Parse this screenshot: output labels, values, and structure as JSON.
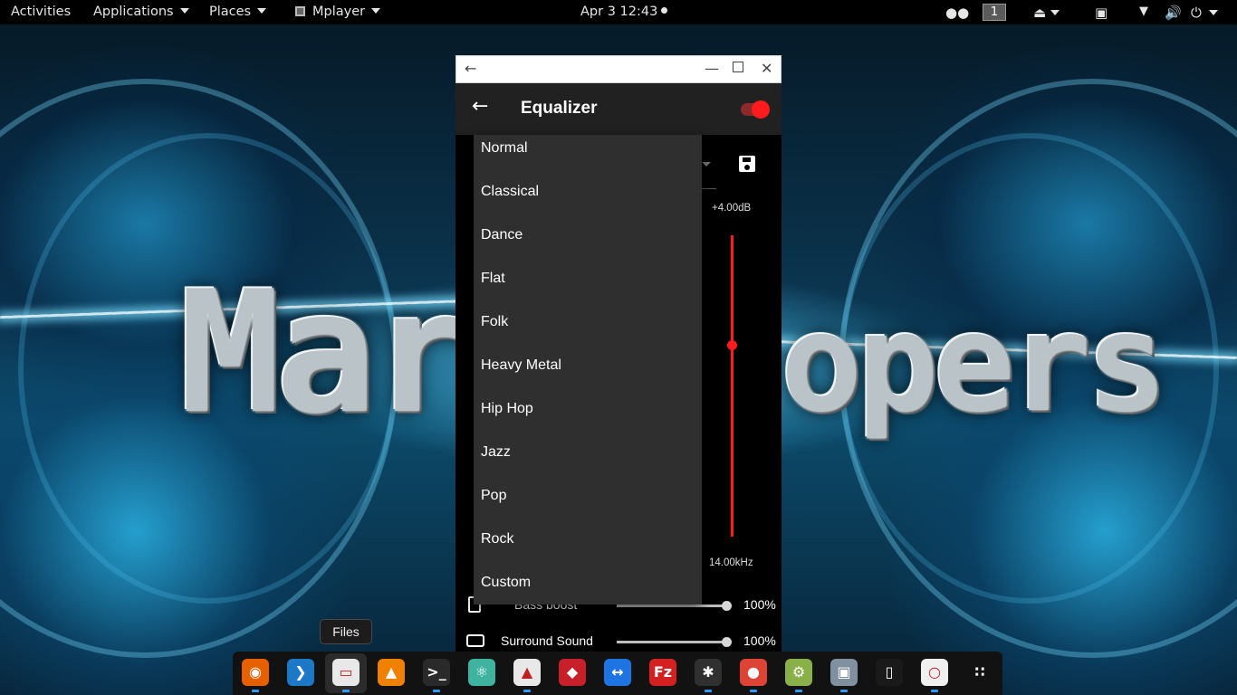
{
  "topbar": {
    "activities": "Activities",
    "applications": "Applications",
    "places": "Places",
    "app_menu": "Mplayer",
    "clock": "Apr 3  12:43",
    "workspace": "1"
  },
  "wallpaper": {
    "text_left": "Mart",
    "text_right": "opers"
  },
  "window": {
    "title": "",
    "app_title": "Equalizer",
    "toggle_on": true,
    "gain_label": "+4.00dB",
    "freq_label": "14.00kHz",
    "bass_boost_label": "Bass boost",
    "bass_boost_value": "100%",
    "bass_boost_level": 1.0,
    "surround_label": "Surround Sound",
    "surround_value": "100%",
    "surround_level": 1.0
  },
  "preset_menu": {
    "items": [
      "Normal",
      "Classical",
      "Dance",
      "Flat",
      "Folk",
      "Heavy Metal",
      "Hip Hop",
      "Jazz",
      "Pop",
      "Rock",
      "Custom"
    ]
  },
  "tooltip": "Files",
  "dock": {
    "apps": [
      "firefox",
      "vscode",
      "files",
      "vlc",
      "terminal",
      "atom",
      "app-red-umbrella",
      "app-red-diamond",
      "teamviewer",
      "filezilla",
      "phone-app",
      "chrome",
      "android-app",
      "virtualbox",
      "mobile-app",
      "screenshot",
      "app-grid"
    ]
  },
  "colors": {
    "accent": "#ff1b1b",
    "appbar": "#212121",
    "menu_bg": "#2f2f2f",
    "dock_indicator": "#2e9bff"
  }
}
